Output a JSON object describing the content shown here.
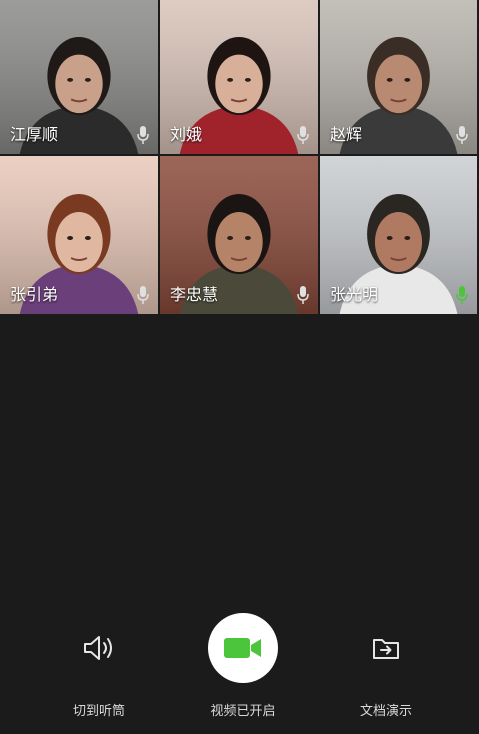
{
  "participants": [
    {
      "name": "江厚顺",
      "mic": "muted",
      "colors": {
        "bg": "#8a8a88",
        "skin": "#c9a08a",
        "hair": "#1f1a18",
        "shirt": "#2b2b2b"
      }
    },
    {
      "name": "刘娥",
      "mic": "muted",
      "colors": {
        "bg": "#d8c3b8",
        "skin": "#d8b09a",
        "hair": "#1e1513",
        "shirt": "#a0232c"
      }
    },
    {
      "name": "赵辉",
      "mic": "muted",
      "colors": {
        "bg": "#b8b4ad",
        "skin": "#b98a72",
        "hair": "#3a2d26",
        "shirt": "#3a3a3a"
      }
    },
    {
      "name": "张引弟",
      "mic": "muted",
      "colors": {
        "bg": "#e8c8b8",
        "skin": "#e0b8a2",
        "hair": "#7a3a22",
        "shirt": "#6b3f7a"
      }
    },
    {
      "name": "李忠慧",
      "mic": "muted",
      "colors": {
        "bg": "#8a4a3a",
        "skin": "#b58468",
        "hair": "#1a1512",
        "shirt": "#4b4a3a"
      }
    },
    {
      "name": "张光明",
      "mic": "active",
      "colors": {
        "bg": "#c9ccd0",
        "skin": "#b07a62",
        "hair": "#2a2622",
        "shirt": "#e8e8e8"
      }
    }
  ],
  "controls": {
    "speaker": {
      "label": "切到听筒",
      "icon": "speaker-icon"
    },
    "video": {
      "label": "视频已开启",
      "icon": "video-camera-icon",
      "accent": "#4cc53d"
    },
    "doc": {
      "label": "文档演示",
      "icon": "share-document-icon"
    }
  }
}
